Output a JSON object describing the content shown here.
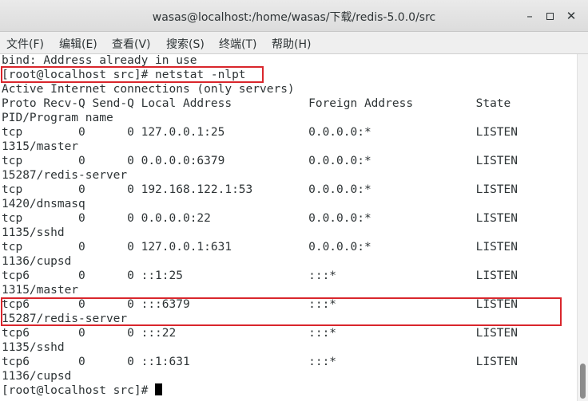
{
  "window": {
    "title": "wasas@localhost:/home/wasas/下载/redis-5.0.0/src",
    "minimize_glyph": "–",
    "close_glyph": "✕"
  },
  "menu": [
    "文件(F)",
    "编辑(E)",
    "查看(V)",
    "搜索(S)",
    "终端(T)",
    "帮助(H)"
  ],
  "terminal": {
    "lines": [
      "bind: Address already in use",
      "[root@localhost src]# netstat -nlpt",
      "Active Internet connections (only servers)",
      "Proto Recv-Q Send-Q Local Address           Foreign Address         State",
      "PID/Program name",
      "tcp        0      0 127.0.0.1:25            0.0.0.0:*               LISTEN",
      "1315/master",
      "tcp        0      0 0.0.0.0:6379            0.0.0.0:*               LISTEN",
      "15287/redis-server",
      "tcp        0      0 192.168.122.1:53        0.0.0.0:*               LISTEN",
      "1420/dnsmasq",
      "tcp        0      0 0.0.0.0:22              0.0.0.0:*               LISTEN",
      "1135/sshd",
      "tcp        0      0 127.0.0.1:631           0.0.0.0:*               LISTEN",
      "1136/cupsd",
      "tcp6       0      0 ::1:25                  :::*                    LISTEN",
      "1315/master",
      "tcp6       0      0 :::6379                 :::*                    LISTEN",
      "15287/redis-server",
      "tcp6       0      0 :::22                   :::*                    LISTEN",
      "1135/sshd",
      "tcp6       0      0 ::1:631                 :::*                    LISTEN",
      "1136/cupsd"
    ],
    "prompt": "[root@localhost src]# "
  },
  "colors": {
    "highlight": "#d9262c",
    "text": "#2e3436",
    "background": "#ffffff"
  }
}
